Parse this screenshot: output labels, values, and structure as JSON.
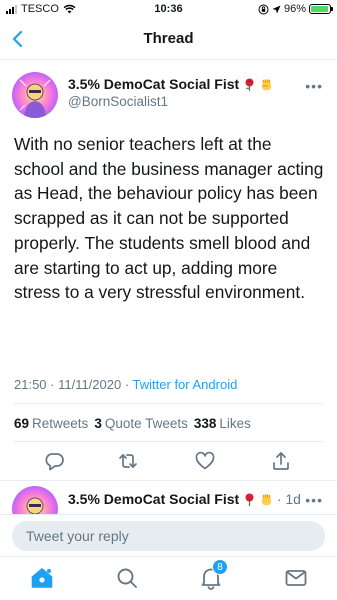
{
  "status_bar": {
    "carrier": "TESCO",
    "time": "10:36",
    "battery": "96%",
    "battery_level": 0.96
  },
  "header": {
    "title": "Thread"
  },
  "tweet": {
    "author_name": "3.5% DemoCat Social Fist",
    "author_handle": "@BornSocialist1",
    "text": "With no senior teachers left at the school and the business manager acting as Head, the behaviour policy has been scrapped as it can not be supported properly. The students smell blood and are starting to act up, adding more stress to a very stressful environment.",
    "timestamp": "21:50 · 11/11/2020 · ",
    "source": "Twitter for Android",
    "stats": [
      {
        "count": "69",
        "label": "Retweets"
      },
      {
        "count": "3",
        "label": "Quote Tweets"
      },
      {
        "count": "338",
        "label": "Likes"
      }
    ]
  },
  "reply_tweet": {
    "author_name": "3.5% DemoCat Social Fist",
    "time": " · 1d"
  },
  "reply_box": {
    "placeholder": "Tweet your reply"
  },
  "tab_bar": {
    "notifications_badge": "8"
  },
  "colors": {
    "accent": "#1da1f2",
    "secondary_text": "#657786",
    "divider": "#e6ecf0"
  }
}
